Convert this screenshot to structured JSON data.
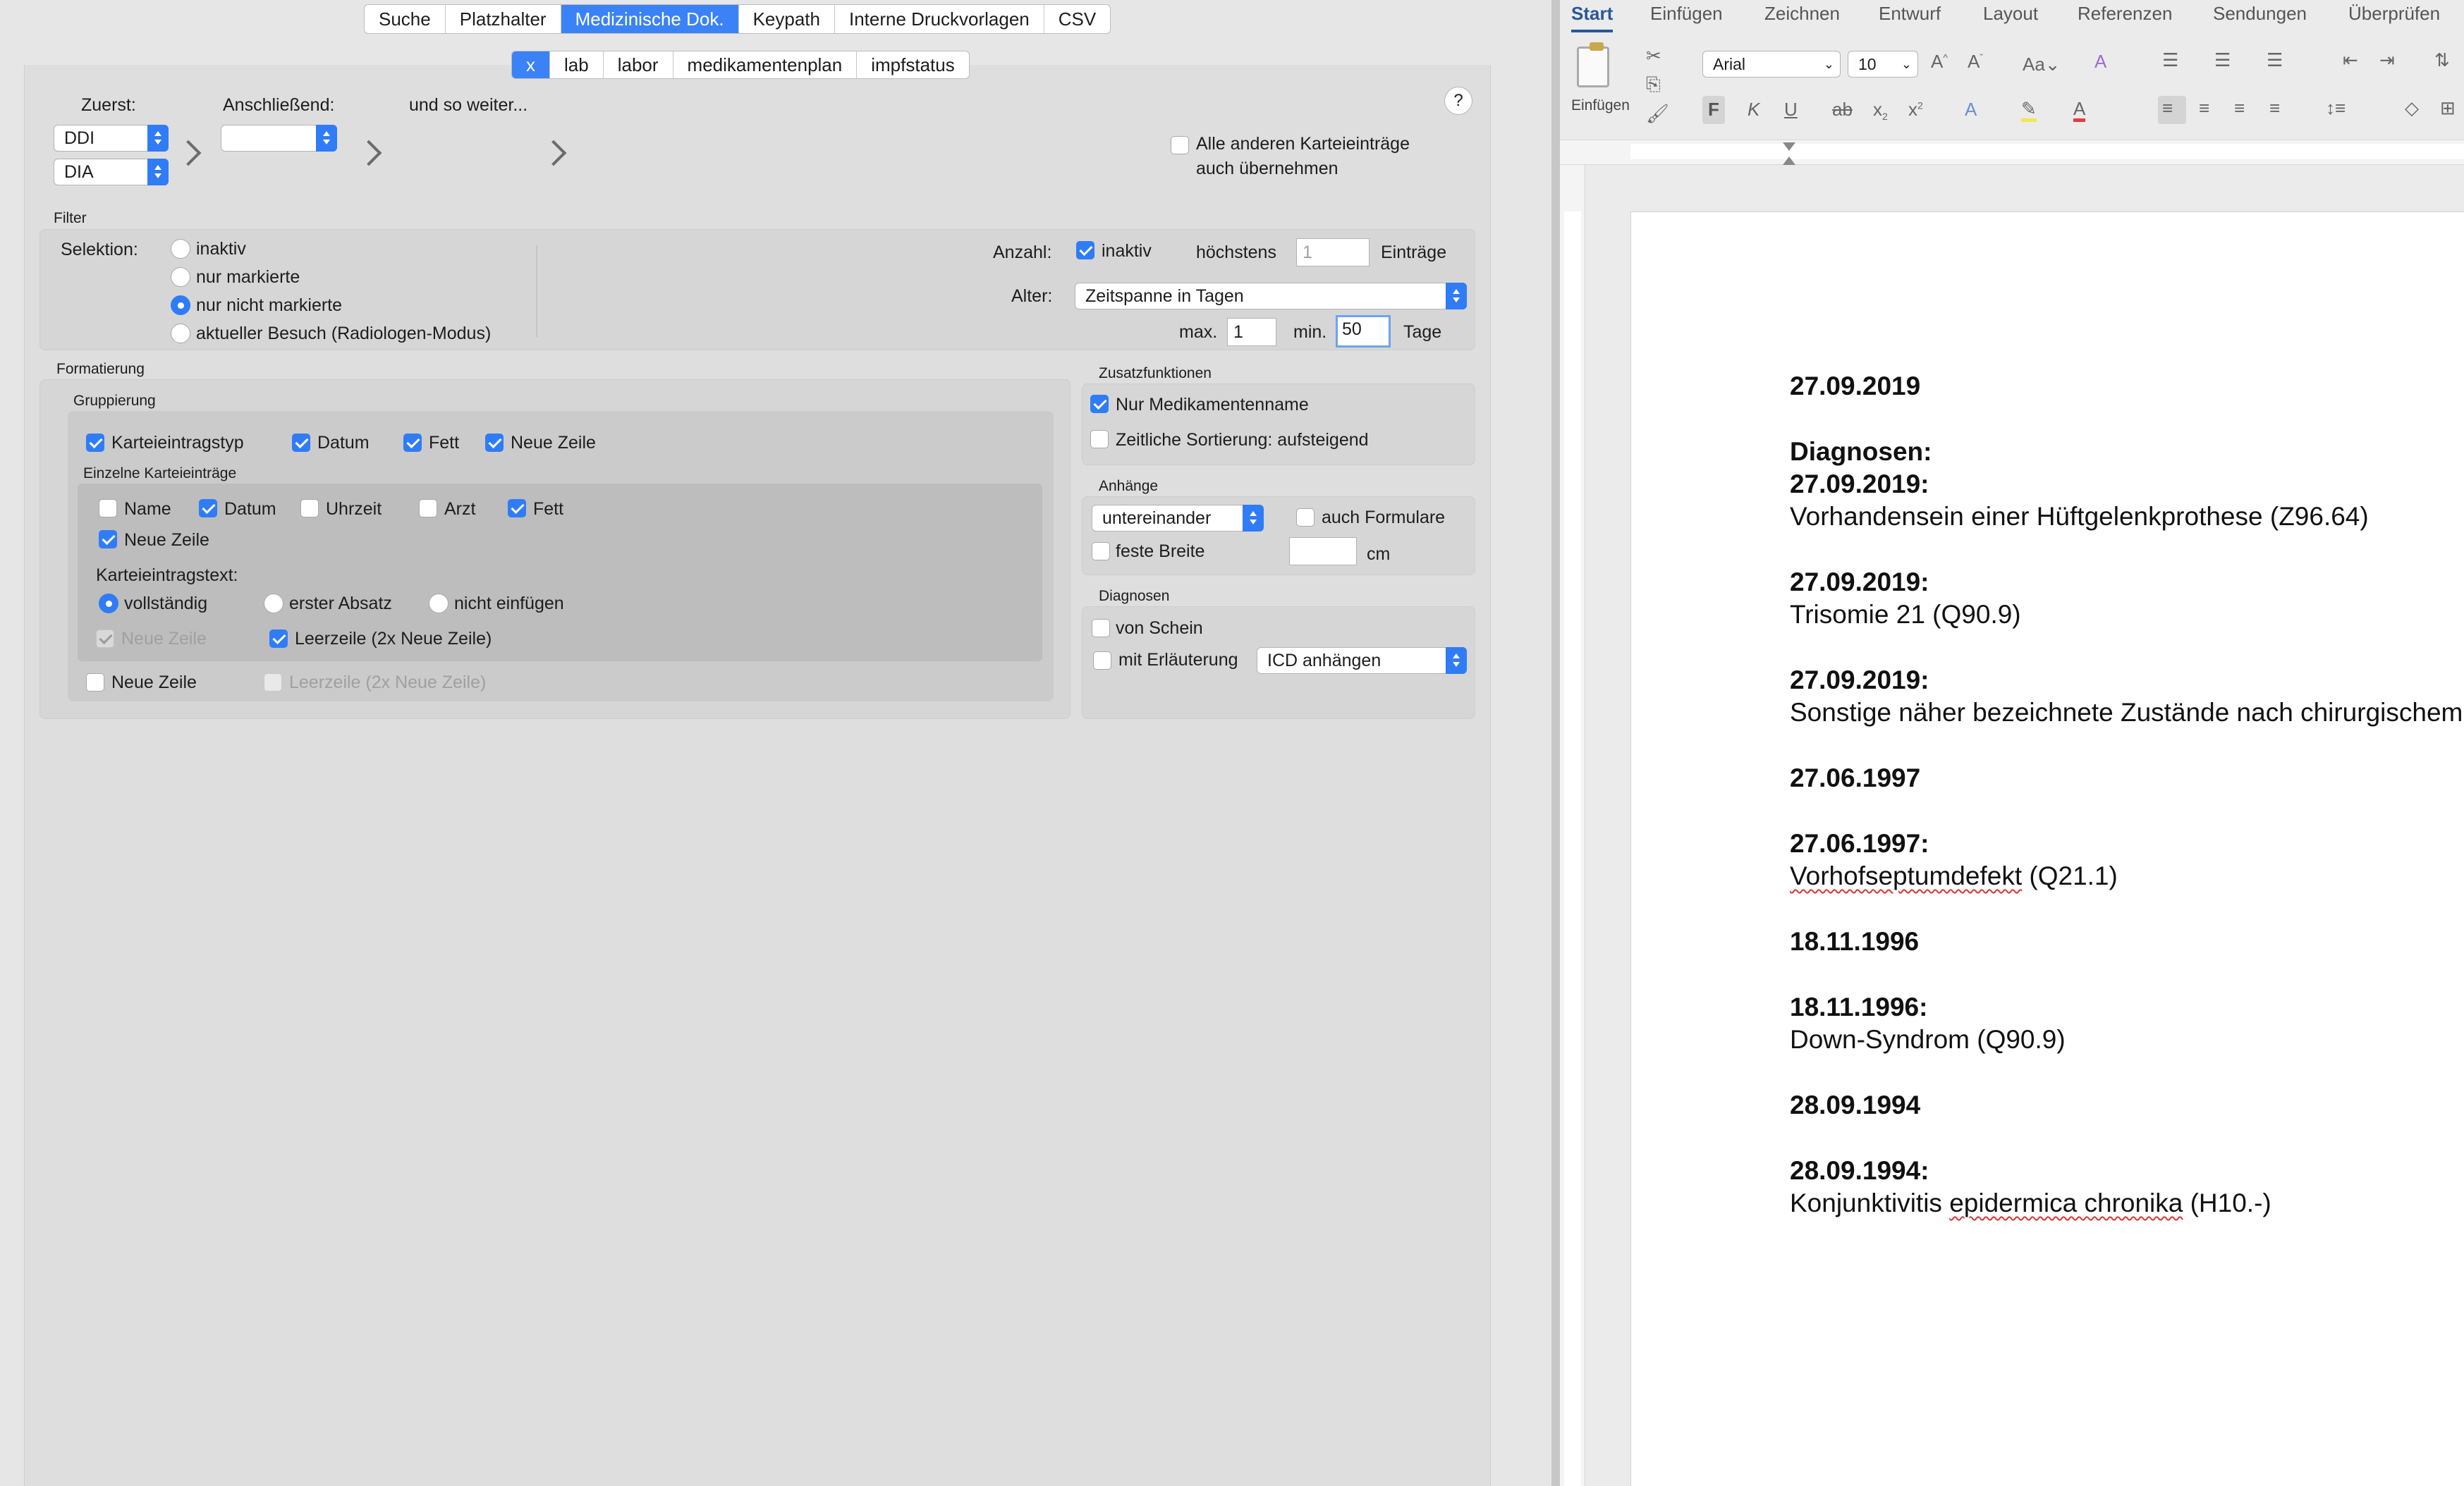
{
  "top_tabs": [
    "Suche",
    "Platzhalter",
    "Medizinische Dok.",
    "Keypath",
    "Interne Druckvorlagen",
    "CSV"
  ],
  "sub_tabs": [
    "x",
    "lab",
    "labor",
    "medikamentenplan",
    "impfstatus"
  ],
  "order": {
    "first_label": "Zuerst:",
    "first_1": "DDI",
    "first_2": "DIA",
    "then_label": "Anschließend:",
    "then_value": "",
    "etc_label": "und so weiter...",
    "help": "?",
    "take_all": "Alle anderen Karteieinträge",
    "take_all_2": "auch übernehmen"
  },
  "filter": {
    "title": "Filter",
    "selection_label": "Selektion:",
    "radios": [
      "inaktiv",
      "nur markierte",
      "nur nicht markierte",
      "aktueller Besuch (Radiologen-Modus)"
    ],
    "count_label": "Anzahl:",
    "count_inactive": "inaktiv",
    "max_label": "höchstens",
    "max_value": "1",
    "entries_label": "Einträge",
    "age_label": "Alter:",
    "age_popup": "Zeitspanne in Tagen",
    "age_max_label": "max.",
    "age_max": "1",
    "age_min_label": "min.",
    "age_min": "50",
    "days_label": "Tage"
  },
  "formatting": {
    "title": "Formatierung",
    "group_title": "Gruppierung",
    "group_checks": [
      "Karteieintragstyp",
      "Datum",
      "Fett",
      "Neue Zeile"
    ],
    "single_title": "Einzelne Karteieinträge",
    "single_checks": [
      "Name",
      "Datum",
      "Uhrzeit",
      "Arzt",
      "Fett"
    ],
    "newline": "Neue Zeile",
    "text_label": "Karteieintragstext:",
    "text_radios": [
      "vollständig",
      "erster Absatz",
      "nicht einfügen"
    ],
    "newline_dis": "Neue Zeile",
    "blank_line": "Leerzeile (2x Neue Zeile)",
    "outer_newline": "Neue Zeile",
    "outer_blank": "Leerzeile (2x Neue Zeile)"
  },
  "extras": {
    "title": "Zusatzfunktionen",
    "med_name": "Nur Medikamentenname",
    "sort": "Zeitliche Sortierung: aufsteigend",
    "attach_title": "Anhänge",
    "attach_popup": "untereinander",
    "also_forms": "auch Formulare",
    "fixed_width": "feste Breite",
    "cm": "cm",
    "diag_title": "Diagnosen",
    "from_schein": "von Schein",
    "with_expl": "mit Erläuterung",
    "icd_popup": "ICD anhängen"
  },
  "word": {
    "tabs": [
      "Start",
      "Einfügen",
      "Zeichnen",
      "Entwurf",
      "Layout",
      "Referenzen",
      "Sendungen",
      "Überprüfen"
    ],
    "paste": "Einfügen",
    "font": "Arial",
    "size": "10",
    "lines": [
      {
        "t": "27.09.2019",
        "b": true
      },
      {
        "t": "Diagnosen:",
        "b": true
      },
      {
        "t": "27.09.2019:",
        "b": true
      },
      {
        "t": "Vorhandensein einer Hüftgelenkprothese (Z96.64)",
        "b": false
      },
      {
        "t": "27.09.2019:",
        "b": true
      },
      {
        "t": "Trisomie 21 (Q90.9)",
        "b": false
      },
      {
        "t": "27.09.2019:",
        "b": true
      },
      {
        "t": "Sonstige näher bezeichnete Zustände nach chirurgischem",
        "b": false
      },
      {
        "t": "27.06.1997",
        "b": true
      },
      {
        "t": "27.06.1997:",
        "b": true
      },
      {
        "t": "(Q21.1)",
        "b": false
      },
      {
        "t": "18.11.1996",
        "b": true
      },
      {
        "t": "18.11.1996:",
        "b": true
      },
      {
        "t": "Down-Syndrom (Q90.9)",
        "b": false
      },
      {
        "t": "28.09.1994",
        "b": true
      },
      {
        "t": "28.09.1994:",
        "b": true
      },
      {
        "t": "Konjunktivitis",
        "b": false
      }
    ],
    "squig1": "Vorhofseptumdefekt",
    "squig2": "epidermica chronika",
    "tail2": "(H10.-)"
  }
}
